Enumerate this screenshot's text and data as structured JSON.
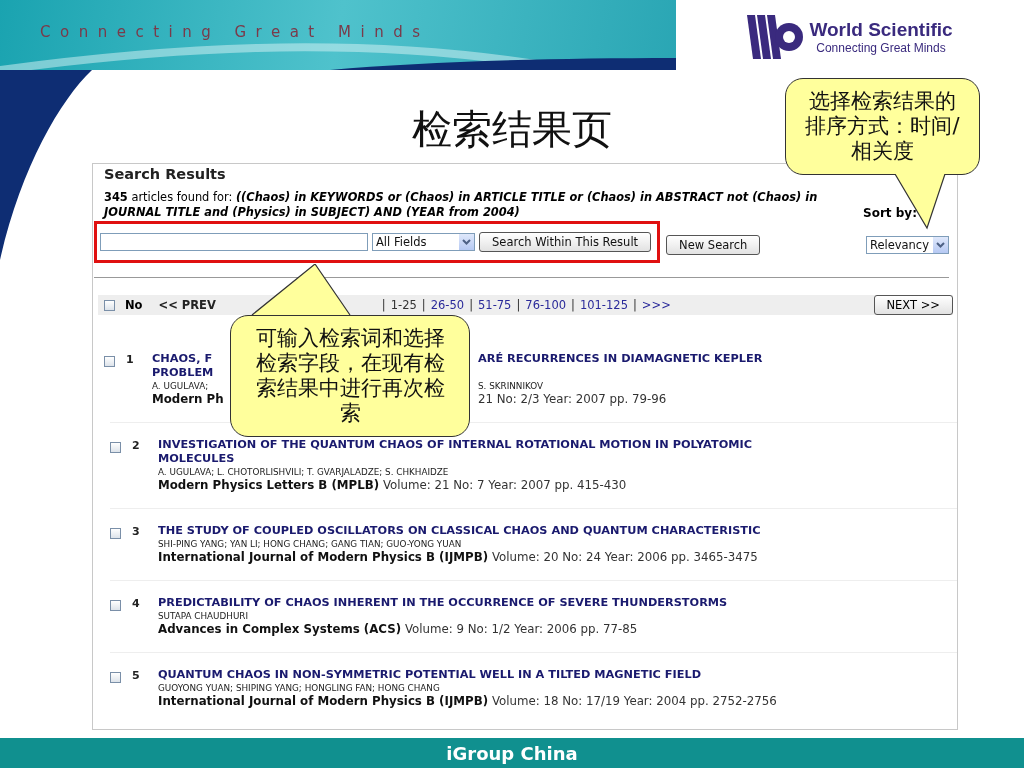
{
  "banner": {
    "tagline": "Connecting Great Minds",
    "logo_name": "World Scientific",
    "logo_tagline": "Connecting Great Minds"
  },
  "slide_title": "检索结果页",
  "results": {
    "heading": "Search Results",
    "count": "345",
    "count_label": "articles found for:",
    "query": "((Chaos) in KEYWORDS or (Chaos) in ARTICLE TITLE or (Chaos) in ABSTRACT not (Chaos) in JOURNAL TITLE and (Physics) in SUBJECT) AND (YEAR from 2004)",
    "sort_label": "Sort by:",
    "sort_value": "Relevancy",
    "search": {
      "field": "All Fields",
      "within_button": "Search Within This Result",
      "new_button": "New Search",
      "highlighted": true
    },
    "pager": {
      "checked": false,
      "no_label": "No",
      "prev": "<< PREV",
      "separator": "|",
      "pages": [
        {
          "label": "1-25",
          "selected": true
        },
        {
          "label": "26-50",
          "selected": false
        },
        {
          "label": "51-75",
          "selected": false
        },
        {
          "label": "76-100",
          "selected": false
        },
        {
          "label": "101-125",
          "selected": false
        },
        {
          "label": ">>>",
          "selected": false
        }
      ],
      "next": "NEXT >>"
    },
    "rows": [
      {
        "number": "1",
        "checked": false,
        "partly_covered": true,
        "title_lines": [
          [
            "CHAOS, F",
            "ARÉ RECURRENCES IN DIAMAGNETIC KEPLER"
          ],
          [
            "PROBLEM"
          ]
        ],
        "authors": [
          "A. UGULAVA;",
          "S. SKRINNIKOV"
        ],
        "journal": "Modern Ph",
        "details": "21 No: 2/3 Year: 2007 pp. 79-96"
      },
      {
        "number": "2",
        "checked": false,
        "partly_covered": false,
        "title_lines": [
          [
            "INVESTIGATION OF THE QUANTUM CHAOS OF INTERNAL ROTATIONAL MOTION IN POLYATOMIC"
          ],
          [
            "MOLECULES"
          ]
        ],
        "authors": [
          "A. UGULAVA; L. CHOTORLISHVILI; T. GVARJALADZE; S. CHKHAIDZE"
        ],
        "journal": "Modern Physics Letters B (MPLB)",
        "details": "Volume: 21 No: 7 Year: 2007 pp. 415-430"
      },
      {
        "number": "3",
        "checked": false,
        "partly_covered": false,
        "title_lines": [
          [
            "THE STUDY OF COUPLED OSCILLATORS ON CLASSICAL CHAOS AND QUANTUM CHARACTERISTIC"
          ]
        ],
        "authors": [
          "SHI-PING YANG; YAN LI; HONG CHANG; GANG TIAN; GUO-YONG YUAN"
        ],
        "journal": "International Journal of Modern Physics B (IJMPB)",
        "details": "Volume: 20 No: 24 Year: 2006 pp. 3465-3475"
      },
      {
        "number": "4",
        "checked": false,
        "partly_covered": false,
        "title_lines": [
          [
            "PREDICTABILITY OF CHAOS INHERENT IN THE OCCURRENCE OF SEVERE THUNDERSTORMS"
          ]
        ],
        "authors": [
          "SUTAPA CHAUDHURI"
        ],
        "journal": "Advances in Complex Systems (ACS)",
        "details": "Volume: 9 No: 1/2 Year: 2006 pp. 77-85"
      },
      {
        "number": "5",
        "checked": false,
        "partly_covered": false,
        "title_lines": [
          [
            "QUANTUM CHAOS IN NON-SYMMETRIC POTENTIAL WELL IN A TILTED MAGNETIC FIELD"
          ]
        ],
        "authors": [
          "GUOYONG YUAN; SHIPING YANG; HONGLING FAN; HONG CHANG"
        ],
        "journal": "International Journal of Modern Physics B (IJMPB)",
        "details": "Volume: 18 No: 17/19 Year: 2004 pp. 2752-2756"
      }
    ]
  },
  "callouts": [
    {
      "kind": "up",
      "text": "可输入检索词和选择检索字段，在现有检索结果中进行再次检索"
    },
    {
      "kind": "down",
      "text": "选择检索结果的排序方式：时间/相关度"
    }
  ],
  "footer": "iGroup China"
}
